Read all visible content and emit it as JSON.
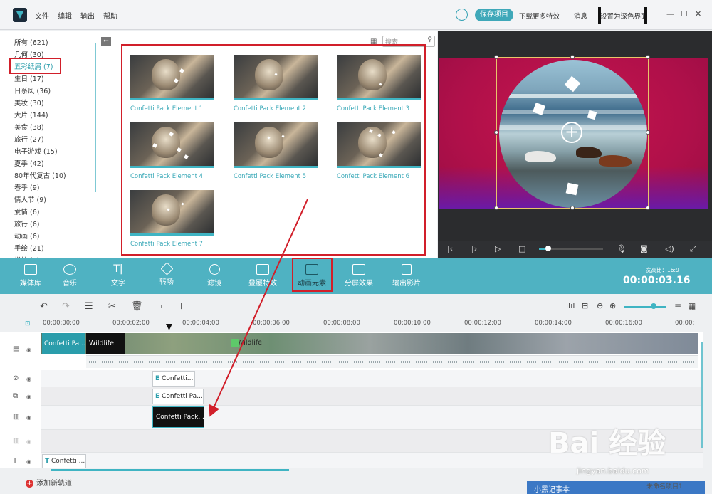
{
  "menu": {
    "file": "文件",
    "edit": "编辑",
    "export": "输出",
    "help": "帮助"
  },
  "titlebar": {
    "save": "保存项目",
    "download": "下载更多特效",
    "messages": "消息",
    "dark_theme": "设置为深色界面"
  },
  "library": {
    "categories": [
      "所有 (621)",
      "几何 (30)",
      "五彩纸屑 (7)",
      "生日 (17)",
      "日系风 (36)",
      "美妆 (30)",
      "大片 (144)",
      "美食 (38)",
      "旅行 (27)",
      "电子游戏 (15)",
      "夏季 (42)",
      "80年代复古 (10)",
      "春季 (9)",
      "情人节 (9)",
      "爱情 (6)",
      "旅行 (6)",
      "动画 (6)",
      "手绘 (21)",
      "学校 (8)"
    ],
    "selected_index": 2
  },
  "search": {
    "placeholder": "搜索"
  },
  "thumbnails": [
    "Confetti Pack Element 1",
    "Confetti Pack Element 2",
    "Confetti Pack Element 3",
    "Confetti Pack Element 4",
    "Confetti Pack Element 5",
    "Confetti Pack Element 6",
    "Confetti Pack Element 7"
  ],
  "toolbar": {
    "tools": [
      "媒体库",
      "音乐",
      "文字",
      "转场",
      "滤镜",
      "叠覆特效",
      "动画元素",
      "分屏效果",
      "输出影片"
    ],
    "active_index": 6,
    "ratio": "宽高比：16:9",
    "timecode": "00:00:03.16"
  },
  "timeline": {
    "ticks": [
      "00:00:00:00",
      "00:00:02:00",
      "00:00:04:00",
      "00:00:06:00",
      "00:00:08:00",
      "00:00:10:00",
      "00:00:12:00",
      "00:00:14:00",
      "00:00:16:00",
      "00:00:"
    ],
    "clip_confetti": "Confetti Pa...",
    "clip_wildlife": "Wildlife",
    "element_clips": [
      "Confetti...",
      "Confetti Pa...",
      "Confetti Pack..."
    ],
    "text_clip": "Confetti ...",
    "add_track": "添加新轨道",
    "status": "未命名项目1"
  },
  "taskbar": {
    "note": "小黑记事本"
  },
  "watermark": {
    "main": "Bai 经验",
    "sub": "jingyan.baidu.com"
  },
  "colors": {
    "accent": "#4fb2c2",
    "highlight": "#d11f2a"
  }
}
